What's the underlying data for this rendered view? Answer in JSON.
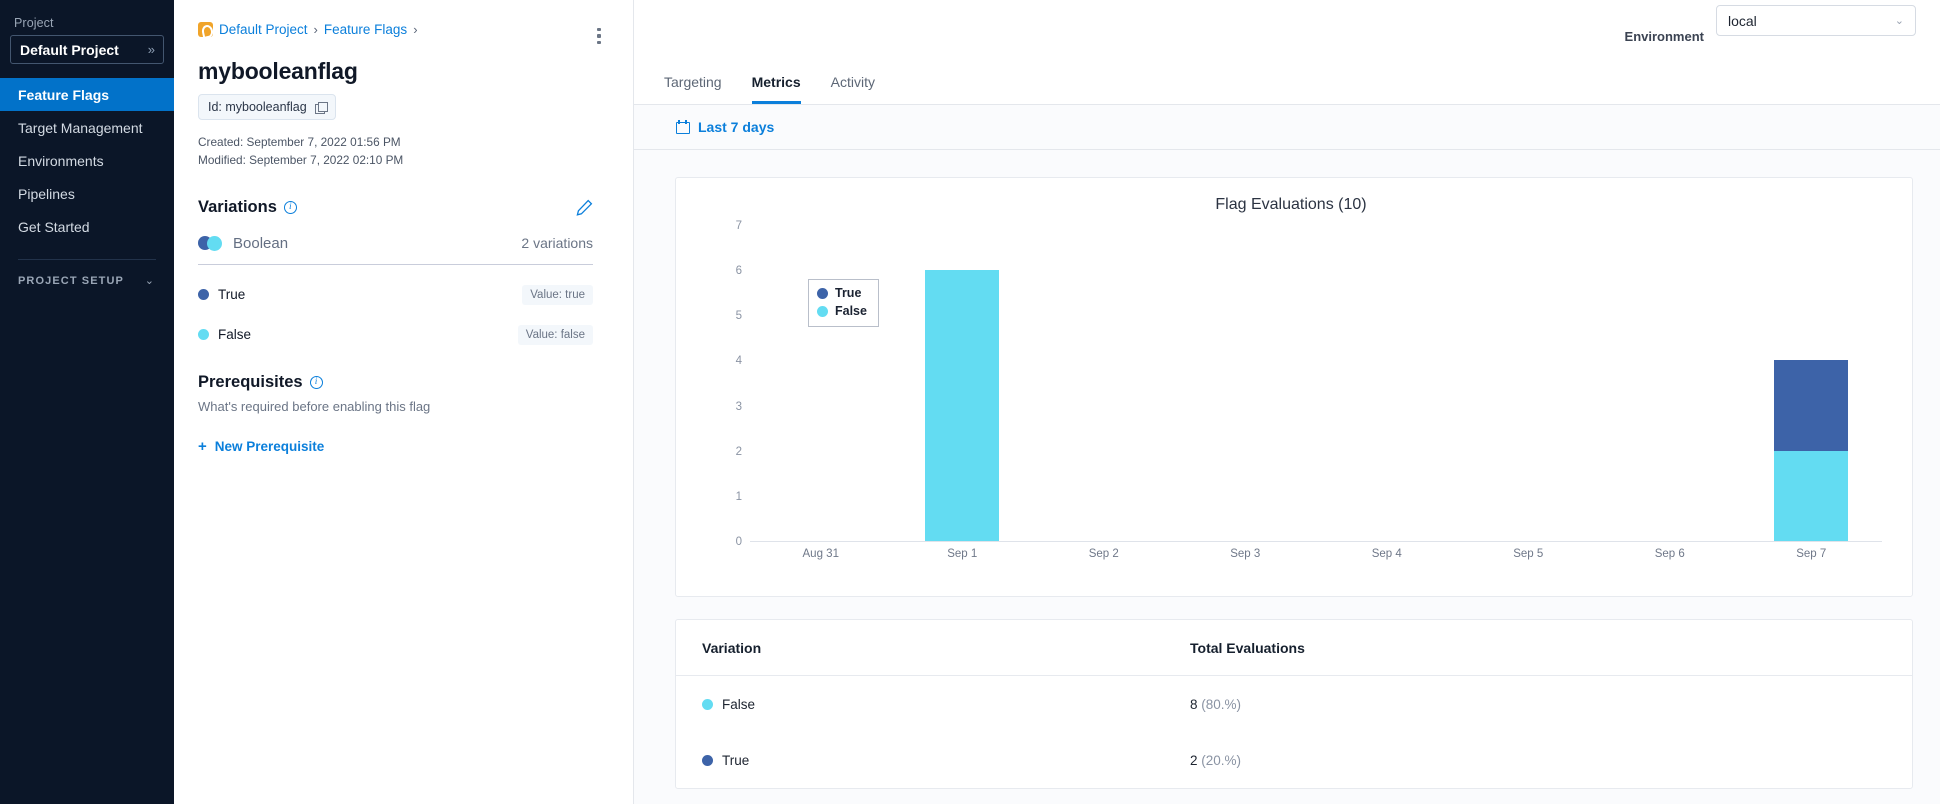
{
  "sidebar": {
    "project_label": "Project",
    "project_name": "Default Project",
    "collapse_icon": "»",
    "items": [
      {
        "label": "Feature Flags",
        "active": true
      },
      {
        "label": "Target Management",
        "active": false
      },
      {
        "label": "Environments",
        "active": false
      },
      {
        "label": "Pipelines",
        "active": false
      },
      {
        "label": "Get Started",
        "active": false
      }
    ],
    "setup_label": "PROJECT SETUP",
    "setup_caret": "⌄"
  },
  "detail": {
    "breadcrumb": [
      {
        "label": "Default Project",
        "sep": "›"
      },
      {
        "label": "Feature Flags",
        "sep": "›"
      }
    ],
    "kebab_icon": "more-vertical-icon",
    "flag_title": "mybooleanflag",
    "id_chip": "Id: mybooleanflag",
    "copy_icon": "copy-icon",
    "created": "Created: September 7, 2022 01:56 PM",
    "modified": "Modified: September 7, 2022 02:10 PM",
    "variations": {
      "title": "Variations",
      "info_icon": "i",
      "edit_icon": "pencil-icon",
      "type_name": "Boolean",
      "count_label": "2 variations",
      "rows": [
        {
          "name": "True",
          "value_label": "Value: true",
          "color": "#3d63a8"
        },
        {
          "name": "False",
          "value_label": "Value: false",
          "color": "#63dcf2"
        }
      ]
    },
    "prerequisites": {
      "title": "Prerequisites",
      "info_icon": "i",
      "subtitle": "What's required before enabling this flag",
      "add_label": "New Prerequisite",
      "add_icon": "+"
    }
  },
  "main": {
    "environment_label": "Environment",
    "environment_value": "local",
    "select_caret": "⌄",
    "tabs": [
      {
        "label": "Targeting",
        "active": false
      },
      {
        "label": "Metrics",
        "active": true
      },
      {
        "label": "Activity",
        "active": false
      }
    ],
    "date_filter": "Last 7 days",
    "calendar_icon": "calendar-icon",
    "table": {
      "headers": [
        "Variation",
        "Total Evaluations"
      ],
      "rows": [
        {
          "variation": "False",
          "color": "#63dcf2",
          "count": "8",
          "percent": "(80.%)"
        },
        {
          "variation": "True",
          "color": "#3d63a8",
          "count": "2",
          "percent": "(20.%)"
        }
      ]
    }
  },
  "chart_data": {
    "type": "bar",
    "stacked": true,
    "title": "Flag Evaluations (10)",
    "xlabel": "",
    "ylabel": "",
    "ylim": [
      0,
      7
    ],
    "yticks": [
      7,
      6,
      5,
      4,
      3,
      2,
      1,
      0
    ],
    "grid": false,
    "legend_position": "top-left",
    "categories": [
      "Aug 31",
      "Sep 1",
      "Sep 2",
      "Sep 3",
      "Sep 4",
      "Sep 5",
      "Sep 6",
      "Sep 7"
    ],
    "series": [
      {
        "name": "True",
        "color": "#3d63a8",
        "values": [
          0,
          0,
          0,
          0,
          0,
          0,
          0,
          2
        ]
      },
      {
        "name": "False",
        "color": "#63dcf2",
        "values": [
          0,
          6,
          0,
          0,
          0,
          0,
          0,
          2
        ]
      }
    ]
  }
}
